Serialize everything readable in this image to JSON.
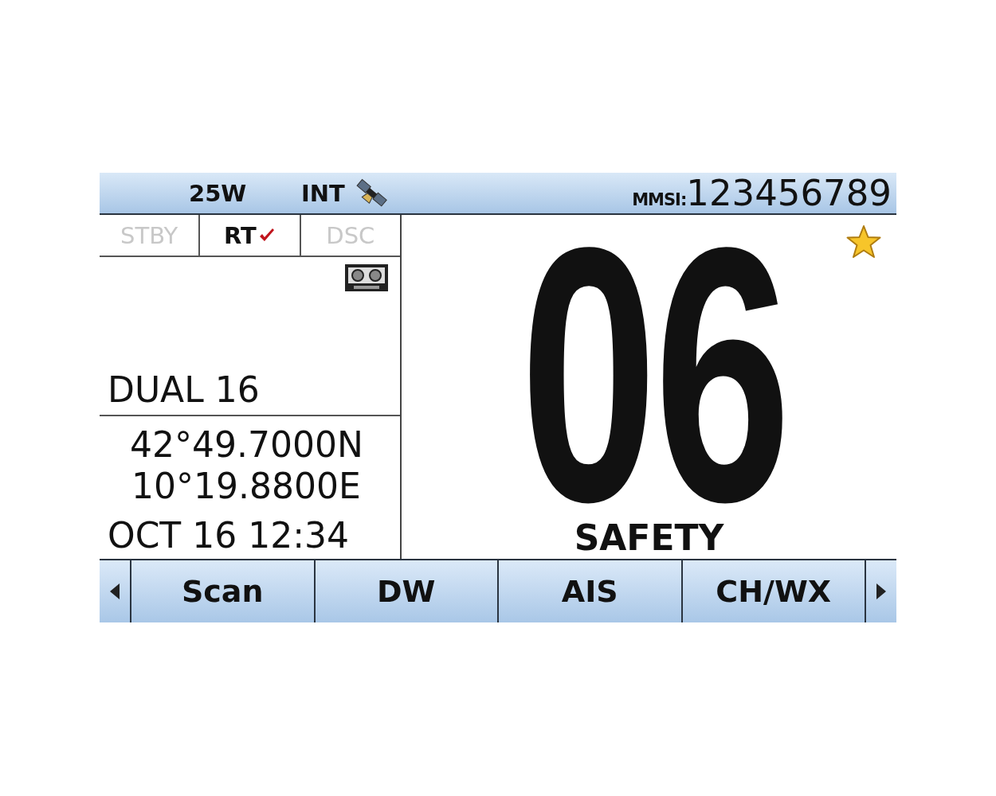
{
  "status_bar": {
    "power": "25W",
    "antenna": "INT",
    "mmsi_label": "MMSI:",
    "mmsi": "123456789"
  },
  "modes": [
    {
      "label": "STBY",
      "selected": false
    },
    {
      "label": "RT",
      "selected": true
    },
    {
      "label": "DSC",
      "selected": false
    }
  ],
  "watch_mode": "DUAL 16",
  "position": {
    "latitude": "42°49.7000N",
    "longitude": "10°19.8800E"
  },
  "datetime": "OCT 16 12:34",
  "channel": {
    "number": "06",
    "name": "SAFETY",
    "favorite": true
  },
  "soft_keys": [
    {
      "label": "Scan"
    },
    {
      "label": "DW"
    },
    {
      "label": "AIS"
    },
    {
      "label": "CH/WX"
    }
  ]
}
